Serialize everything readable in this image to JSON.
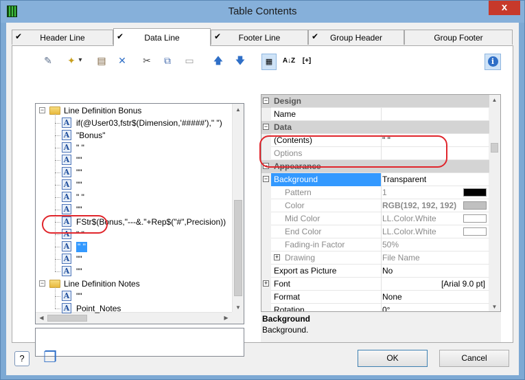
{
  "window": {
    "title": "Table Contents",
    "close_glyph": "x"
  },
  "tabs": [
    {
      "label": "Header Line",
      "checked": true,
      "active": false
    },
    {
      "label": "Data Line",
      "checked": true,
      "active": true
    },
    {
      "label": "Footer Line",
      "checked": true,
      "active": false
    },
    {
      "label": "Group Header",
      "checked": true,
      "active": false
    },
    {
      "label": "Group Footer",
      "checked": false,
      "active": false
    }
  ],
  "tree_toolbar": [
    {
      "name": "wizard-icon",
      "glyph": "✎"
    },
    {
      "name": "new-item-icon",
      "glyph": "✦"
    },
    {
      "name": "dropdown-arrow-icon",
      "glyph": "▾"
    },
    {
      "name": "properties-icon",
      "glyph": "▤"
    },
    {
      "name": "delete-icon",
      "glyph": "✕"
    },
    {
      "name": "cut-icon",
      "glyph": "✂"
    },
    {
      "name": "copy-icon",
      "glyph": "⧉"
    },
    {
      "name": "paste-icon",
      "glyph": "▭"
    },
    {
      "name": "move-up-icon",
      "glyph": "🡅"
    },
    {
      "name": "move-down-icon",
      "glyph": "🡇"
    }
  ],
  "tree": {
    "group1": {
      "label": "Line Definition Bonus",
      "expander": "−"
    },
    "items1": [
      "if(@User03,fstr$(Dimension,'#####'),\" \")",
      "\"Bonus\"",
      "\" \"",
      "\"\"",
      "\"\"",
      "\"\"",
      "\" \"",
      "\"\"",
      "FStr$(Bonus,\"---&.\"+Rep$(\"#\",Precision))",
      "\" \"",
      "\" \"",
      "\"\"",
      "\"\""
    ],
    "group2": {
      "label": "Line Definition Notes",
      "expander": "−"
    },
    "items2": [
      "\"\"",
      "Point_Notes"
    ]
  },
  "property_toolbar": {
    "categorized_icon": "▦",
    "sort_icon": "A↓Z",
    "expand_all_label": "[+]",
    "info_icon": "i"
  },
  "properties": [
    {
      "type": "cat",
      "name": "Design",
      "exp": "−"
    },
    {
      "type": "row",
      "name": "Name",
      "value": ""
    },
    {
      "type": "cat",
      "name": "Data",
      "exp": "−"
    },
    {
      "type": "row",
      "name": "(Contents)",
      "value": "\" \""
    },
    {
      "type": "row",
      "name": "Options",
      "value": "",
      "grey": true
    },
    {
      "type": "cat",
      "name": "Appearance",
      "exp": "−"
    },
    {
      "type": "sel",
      "name": "Background",
      "value": "Transparent",
      "exp": "−"
    },
    {
      "type": "row",
      "name": "Pattern",
      "value": "1",
      "grey": true,
      "indent": true,
      "swatch": "#000000"
    },
    {
      "type": "row",
      "name": "Color",
      "value": "RGB(192, 192, 192)",
      "grey": true,
      "indent": true,
      "swatch": "#c0c0c0"
    },
    {
      "type": "row",
      "name": "Mid Color",
      "value": "LL.Color.White",
      "grey": true,
      "indent": true,
      "swatch": "#ffffff"
    },
    {
      "type": "row",
      "name": "End Color",
      "value": "LL.Color.White",
      "grey": true,
      "indent": true,
      "swatch": "#ffffff"
    },
    {
      "type": "row",
      "name": "Fading-in Factor",
      "value": "50%",
      "grey": true,
      "indent": true
    },
    {
      "type": "row",
      "name": "Drawing",
      "value": "File Name",
      "grey": true,
      "indent": true,
      "exp": "+"
    },
    {
      "type": "row",
      "name": "Export as Picture",
      "value": "No"
    },
    {
      "type": "row",
      "name": "Font",
      "value": "[Arial 9.0 pt]",
      "exp": "+",
      "right": true
    },
    {
      "type": "row",
      "name": "Format",
      "value": "None"
    },
    {
      "type": "row",
      "name": "Rotation",
      "value": "0°"
    }
  ],
  "help": {
    "title": "Background",
    "description": "Background."
  },
  "footer": {
    "help_icon": "?",
    "window_icon": "❐",
    "ok_label": "OK",
    "cancel_label": "Cancel"
  },
  "colors": {
    "titlebar": "#86b0da",
    "selection": "#3399ff",
    "highlight_ring": "#e0242a",
    "close_button": "#c7392b"
  }
}
